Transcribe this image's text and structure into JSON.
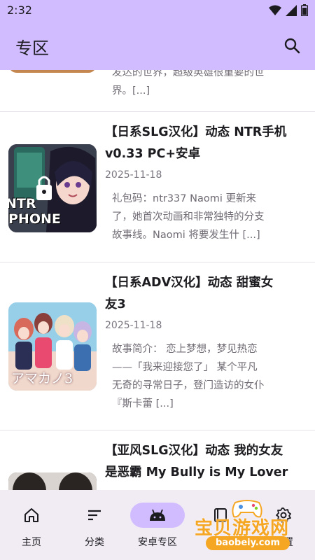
{
  "status_bar": {
    "time": "2:32"
  },
  "app_bar": {
    "title": "专区",
    "search_icon": "search-icon"
  },
  "articles": [
    {
      "title_lines": [],
      "date": "",
      "excerpt_lines": [
        "发达的世界，超级英雄很重要的世",
        "界。[...]"
      ]
    },
    {
      "title_lines": [
        "【日系SLG汉化】动态 NTR手机",
        "v0.33 PC+安卓"
      ],
      "date": "2025-11-18",
      "thumb_text_1": "NTR",
      "thumb_text_2": "PHONE",
      "excerpt_lines": [
        "礼包码：ntr337 Naomi 更新来",
        "了，她首次动画和非常独特的分支",
        "故事线。Naomi 将要发生什 [...]"
      ]
    },
    {
      "title_lines": [
        "【日系ADV汉化】动态 甜蜜女",
        "友3"
      ],
      "date": "2025-11-18",
      "thumb_text": "アマカノ3",
      "excerpt_lines": [
        "故事简介： 恋上梦想，梦见热恋",
        "——「我来迎接您了」 某个平凡",
        "无奇的寻常日子，登门造访的女仆",
        "『斯卡蕾 [...]"
      ]
    },
    {
      "title_lines": [
        "【亚风SLG汉化】动态 我的女友",
        "是恶霸 My Bully is My Lover"
      ],
      "date": "",
      "excerpt_lines": []
    }
  ],
  "bottom_nav": [
    {
      "label": "主页",
      "icon": "home-icon",
      "active": false
    },
    {
      "label": "分类",
      "icon": "sort-icon",
      "active": false
    },
    {
      "label": "安卓专区",
      "icon": "android-icon",
      "active": true
    },
    {
      "label": "",
      "icon": "book-icon",
      "active": false
    },
    {
      "label": "设置",
      "icon": "gear-icon",
      "active": false
    }
  ],
  "watermark": {
    "text": "宝贝游戏网",
    "url": "baobeiy.com"
  },
  "colors": {
    "header": "#d0bcff",
    "nav_bg": "#f1ecf4",
    "active_pill": "#d0bcff",
    "watermark": "#f5a623"
  }
}
